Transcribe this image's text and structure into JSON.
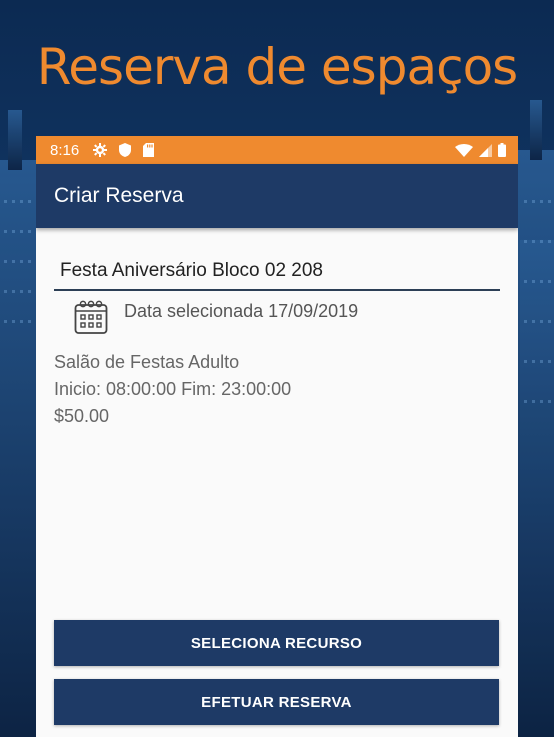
{
  "promo": {
    "title": "Reserva de espaços"
  },
  "status_bar": {
    "time": "8:16"
  },
  "app_bar": {
    "title": "Criar Reserva"
  },
  "form": {
    "event_name": "Festa Aniversário Bloco 02 208",
    "date_label": "Data selecionada 17/09/2019"
  },
  "resource": {
    "name": "Salão de Festas Adulto",
    "schedule": "Inicio: 08:00:00 Fim: 23:00:00",
    "price": "$50.00"
  },
  "buttons": {
    "select_resource": "SELECIONA RECURSO",
    "make_reservation": "EFETUAR RESERVA"
  },
  "colors": {
    "accent_orange": "#ef8a2f",
    "primary_blue": "#1e3a66"
  },
  "icons": {
    "status_left": [
      "gear-icon",
      "shield-icon",
      "sd-card-icon"
    ],
    "status_right": [
      "wifi-icon",
      "signal-icon",
      "battery-icon"
    ],
    "date": "calendar-icon"
  }
}
